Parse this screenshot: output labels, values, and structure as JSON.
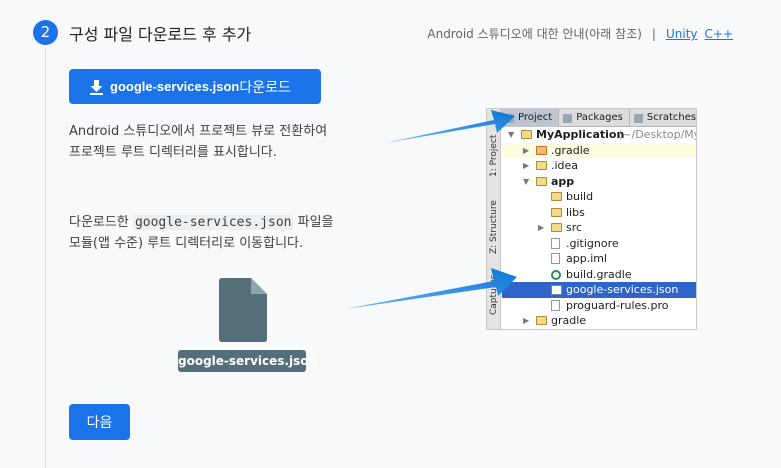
{
  "step": {
    "number": "2",
    "title": "구성 파일 다운로드 후 추가"
  },
  "help": {
    "text": "Android 스튜디오에 대한 안내(아래 참조)",
    "separator": "|",
    "links": [
      "Unity",
      "C++"
    ]
  },
  "download_button": {
    "filename": "google-services.json",
    "suffix": " 다운로드"
  },
  "instructions": {
    "line1a": "Android 스튜디오에서 프로젝트 뷰로 전환하여",
    "line1b": "프로젝트 루트 디렉터리를 표시합니다.",
    "line2_pre": "다운로드한 ",
    "line2_code": "google-services.json",
    "line2_post": " 파일을",
    "line2b": "모듈(앱 수준) 루트 디렉터리로 이동합니다."
  },
  "file_label": "google-services.json",
  "next_button": "다음",
  "ide": {
    "tabs": [
      "Project",
      "Packages",
      "Scratches"
    ],
    "side_tabs": [
      "1: Project",
      "Z: Structure",
      "Captures"
    ],
    "tree": [
      {
        "label": "MyApplication",
        "extra": " (~/Desktop/My",
        "level": 0,
        "expanded": true,
        "icon": "module-folder-icon"
      },
      {
        "label": ".gradle",
        "level": 1,
        "expanded": false,
        "icon": "folder-icon",
        "highlighted": true
      },
      {
        "label": ".idea",
        "level": 1,
        "expanded": false,
        "icon": "folder-icon"
      },
      {
        "label": "app",
        "level": 1,
        "expanded": true,
        "icon": "module-folder-icon"
      },
      {
        "label": "build",
        "level": 2,
        "icon": "folder-icon"
      },
      {
        "label": "libs",
        "level": 2,
        "icon": "folder-icon"
      },
      {
        "label": "src",
        "level": 2,
        "expanded": false,
        "icon": "folder-icon"
      },
      {
        "label": ".gitignore",
        "level": 2,
        "icon": "file-icon"
      },
      {
        "label": "app.iml",
        "level": 2,
        "icon": "file-icon"
      },
      {
        "label": "build.gradle",
        "level": 2,
        "icon": "gradle-icon"
      },
      {
        "label": "google-services.json",
        "level": 2,
        "icon": "json-file-icon",
        "selected": true
      },
      {
        "label": "proguard-rules.pro",
        "level": 2,
        "icon": "file-icon"
      },
      {
        "label": "gradle",
        "level": 1,
        "expanded": false,
        "icon": "folder-icon"
      }
    ]
  },
  "colors": {
    "accent": "#1a73e8",
    "file_label_bg": "#546e7a",
    "selection": "#2f65ca",
    "arrow": "#1e88e5"
  }
}
